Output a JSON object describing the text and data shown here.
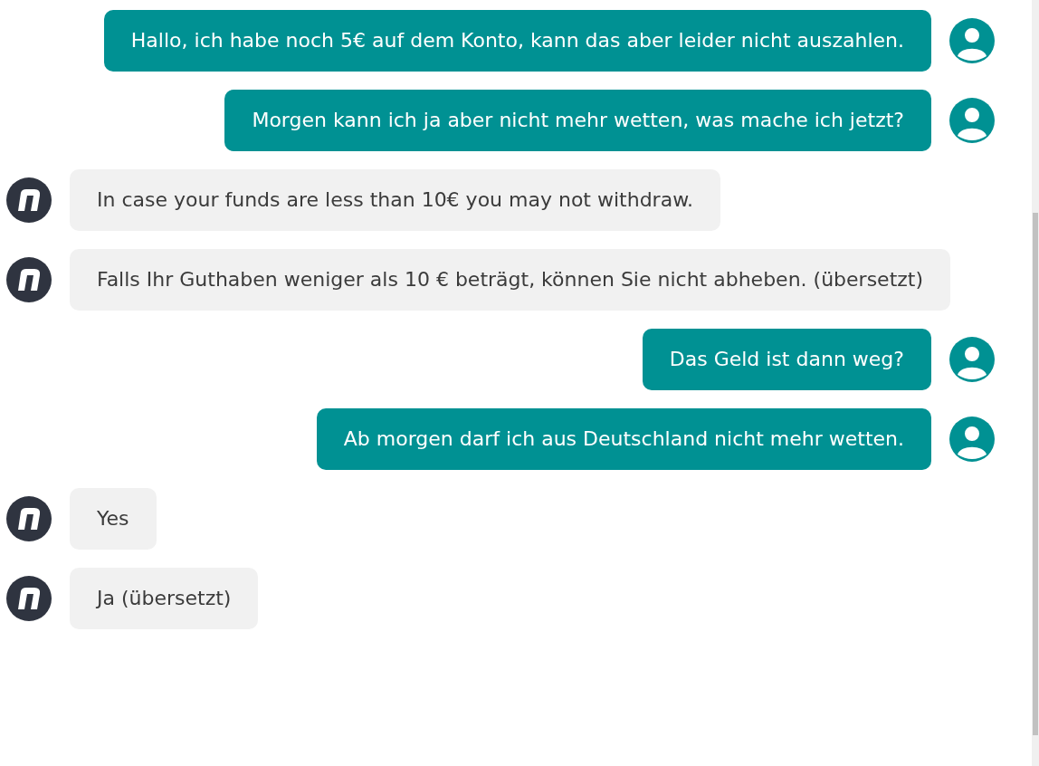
{
  "messages": [
    {
      "kind": "user",
      "text": "Hallo, ich habe noch 5€ auf dem Konto, kann das aber leider nicht auszahlen."
    },
    {
      "kind": "user",
      "text": "Morgen kann ich ja aber nicht mehr wetten, was mache ich jetzt?"
    },
    {
      "kind": "bot",
      "text": "In case your funds are less than 10€ you may not withdraw."
    },
    {
      "kind": "bot",
      "text": "Falls Ihr Guthaben weniger als 10 € beträgt, können Sie nicht abheben. (übersetzt)"
    },
    {
      "kind": "user",
      "text": "Das Geld ist dann weg?"
    },
    {
      "kind": "user",
      "text": "Ab morgen darf ich aus Deutschland nicht mehr wetten."
    },
    {
      "kind": "bot",
      "text": "Yes"
    },
    {
      "kind": "bot",
      "text": "Ja (übersetzt)"
    }
  ]
}
